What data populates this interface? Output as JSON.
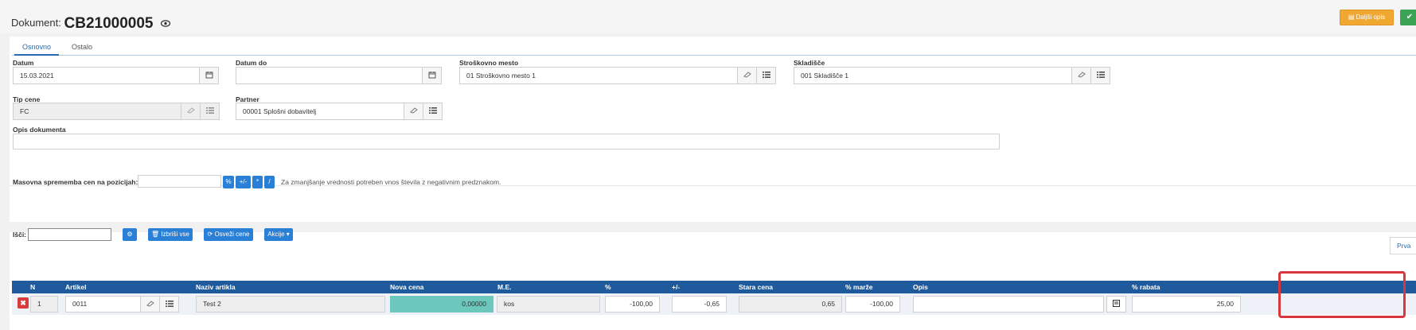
{
  "header": {
    "doc_label": "Dokument:",
    "doc_number": "CB21000005",
    "btn_more_label": "Daljši opis",
    "btn_save_label": "✔"
  },
  "tabs": [
    {
      "label": "Osnovno",
      "active": true
    },
    {
      "label": "Ostalo",
      "active": false
    }
  ],
  "form": {
    "datum": {
      "label": "Datum",
      "value": "15.03.2021"
    },
    "datum_do": {
      "label": "Datum do",
      "value": ""
    },
    "stroskovno_mesto": {
      "label": "Stroškovno mesto",
      "value": "01 Stroškovno mesto 1"
    },
    "skladisce": {
      "label": "Skladišče",
      "value": "001 Skladišče 1"
    },
    "tip_cene": {
      "label": "Tip cene",
      "value": "FC"
    },
    "partner": {
      "label": "Partner",
      "value": "00001 Splošni dobavitelj"
    },
    "opis_dokumenta": {
      "label": "Opis dokumenta",
      "value": ""
    }
  },
  "mass_change": {
    "label": "Masovna sprememba cen na pozicijah:",
    "value": "",
    "buttons": [
      "%",
      "+/-",
      "*",
      "/"
    ],
    "note": "Za zmanjšanje vrednosti potreben vnos števila z negativnim predznakom."
  },
  "toolbar": {
    "search_label": "Išči:",
    "search_value": "",
    "delete_all_label": "Izbriši vse",
    "refresh_prices_label": "Osveži cene",
    "actions_label": "Akcije",
    "prva_label": "Prva"
  },
  "grid": {
    "columns": [
      "N",
      "Artikel",
      "Naziv artikla",
      "Nova cena",
      "M.E.",
      "%",
      "+/-",
      "Stara cena",
      "% marže",
      "Opis",
      "% rabata"
    ],
    "rows": [
      {
        "n": "1",
        "artikel": "0011",
        "naziv": "Test 2",
        "nova_cena": "0,00000",
        "me": "kos",
        "pct": "-100,00",
        "plusminus": "-0,65",
        "stara_cena": "0,65",
        "marza": "-100,00",
        "opis": "",
        "rabat": "25,00"
      }
    ]
  },
  "colors": {
    "accent": "#2a7fd6",
    "grid_header": "#1f5a9c",
    "highlight": "#d9363e",
    "nova_cena_bg": "#6cc7bd",
    "orange": "#f0a830",
    "green": "#3aa454"
  }
}
